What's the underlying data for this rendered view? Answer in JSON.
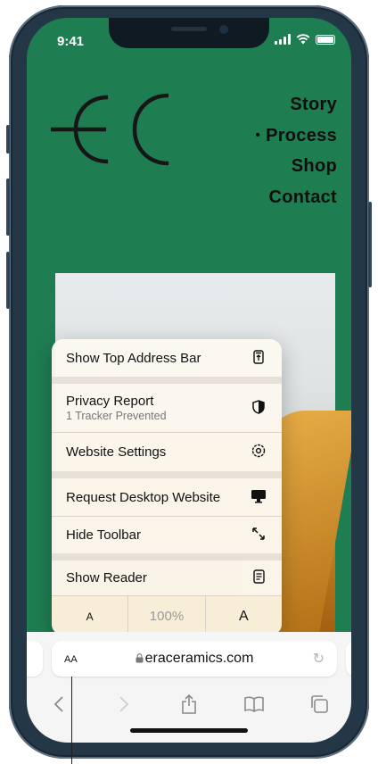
{
  "status_bar": {
    "time": "9:41"
  },
  "site": {
    "nav": [
      {
        "label": "Story",
        "active": false
      },
      {
        "label": "Process",
        "active": true
      },
      {
        "label": "Shop",
        "active": false
      },
      {
        "label": "Contact",
        "active": false
      }
    ],
    "active_marker": "•",
    "bg_color": "#1f7d52"
  },
  "menu": {
    "items": [
      {
        "label": "Show Top Address Bar",
        "icon": "top-address-bar-icon"
      },
      {
        "label": "Privacy Report",
        "sublabel": "1 Tracker Prevented",
        "icon": "shield-icon"
      },
      {
        "label": "Website Settings",
        "icon": "gear-icon"
      },
      {
        "label": "Request Desktop Website",
        "icon": "desktop-icon"
      },
      {
        "label": "Hide Toolbar",
        "icon": "resize-arrows-icon"
      },
      {
        "label": "Show Reader",
        "icon": "reader-icon"
      }
    ],
    "zoom": {
      "decrease": "A",
      "level": "100%",
      "increase": "A"
    }
  },
  "toolbar": {
    "aa_label": "AA",
    "url": "eraceramics.com",
    "back_icon": "chevron-left-icon",
    "forward_icon": "chevron-right-icon",
    "share_icon": "share-icon",
    "bookmarks_icon": "book-icon",
    "tabs_icon": "tabs-icon"
  }
}
